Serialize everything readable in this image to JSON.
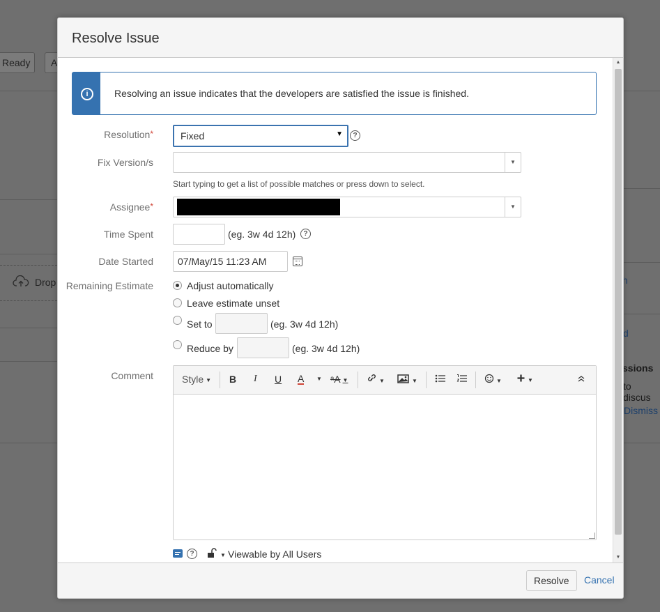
{
  "background": {
    "button_ready": "Ready",
    "button_a": "A",
    "drop_text": "Drop",
    "link_h": "h",
    "link_d": "d",
    "discussions_title": "ssions",
    "discussions_text": "to discus",
    "dismiss_link": "Dismiss"
  },
  "dialog": {
    "title": "Resolve Issue",
    "info_message": "Resolving an issue indicates that the developers are satisfied the issue is finished.",
    "resolution": {
      "label": "Resolution",
      "required": "*",
      "value": "Fixed"
    },
    "fix_versions": {
      "label": "Fix Version/s",
      "value": "",
      "hint": "Start typing to get a list of possible matches or press down to select."
    },
    "assignee": {
      "label": "Assignee",
      "required": "*"
    },
    "time_spent": {
      "label": "Time Spent",
      "value": "",
      "hint": "(eg. 3w 4d 12h)"
    },
    "date_started": {
      "label": "Date Started",
      "value": "07/May/15 11:23 AM"
    },
    "remaining_estimate": {
      "label": "Remaining Estimate",
      "options": [
        {
          "label": "Adjust automatically",
          "checked": true
        },
        {
          "label": "Leave estimate unset",
          "checked": false
        },
        {
          "label": "Set to",
          "hint": "(eg. 3w 4d 12h)",
          "checked": false
        },
        {
          "label": "Reduce by",
          "hint": "(eg. 3w 4d 12h)",
          "checked": false
        }
      ]
    },
    "comment": {
      "label": "Comment",
      "toolbar": {
        "style": "Style",
        "bold": "B",
        "italic": "I",
        "underline": "U",
        "text_color": "A",
        "text_style": "ᵃA"
      },
      "value": ""
    },
    "visibility": "Viewable by All Users",
    "resolve_button": "Resolve",
    "cancel_link": "Cancel"
  },
  "colors": {
    "accent": "#3572b0",
    "required": "#d04437",
    "overlay": "#6f6f6f"
  }
}
